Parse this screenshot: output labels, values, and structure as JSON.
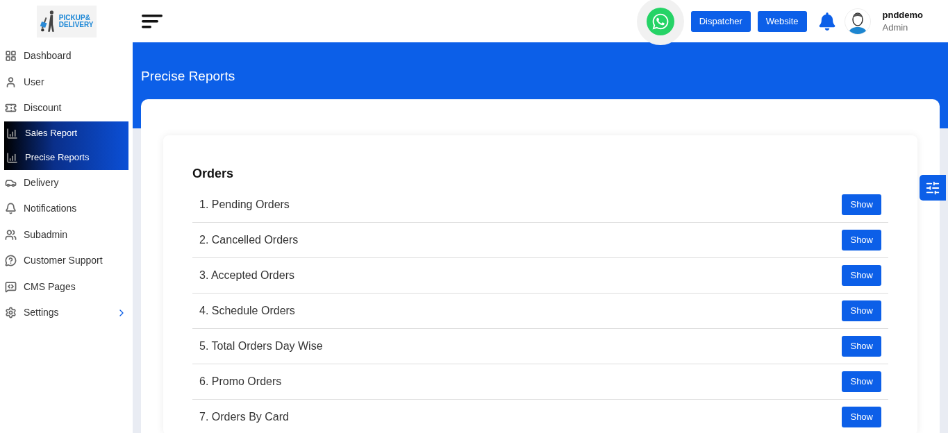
{
  "logo": {
    "line_1": "PICKUP&",
    "line_2": "DELIVERY"
  },
  "sidebar": {
    "items": [
      {
        "label": "Dashboard",
        "selected": false,
        "expandable": false
      },
      {
        "label": "User",
        "selected": false,
        "expandable": false
      },
      {
        "label": "Discount",
        "selected": false,
        "expandable": false
      },
      {
        "label": "Sales Report",
        "selected": true,
        "expandable": false
      },
      {
        "label": "Precise Reports",
        "selected": true,
        "expandable": false
      },
      {
        "label": "Delivery",
        "selected": false,
        "expandable": false
      },
      {
        "label": "Notifications",
        "selected": false,
        "expandable": false
      },
      {
        "label": "Subadmin",
        "selected": false,
        "expandable": false
      },
      {
        "label": "Customer Support",
        "selected": false,
        "expandable": false
      },
      {
        "label": "CMS Pages",
        "selected": false,
        "expandable": false
      },
      {
        "label": "Settings",
        "selected": false,
        "expandable": true
      }
    ]
  },
  "header": {
    "buttons": [
      "Dispatcher",
      "Website"
    ],
    "user": {
      "name": "pnddemo",
      "role": "Admin"
    }
  },
  "page_title": "Precise Reports",
  "section_title": "Orders",
  "reports": [
    {
      "label": "1. Pending Orders",
      "button": "Show"
    },
    {
      "label": "2. Cancelled Orders",
      "button": "Show"
    },
    {
      "label": "3. Accepted Orders",
      "button": "Show"
    },
    {
      "label": "4. Schedule Orders",
      "button": "Show"
    },
    {
      "label": "5. Total Orders Day Wise",
      "button": "Show"
    },
    {
      "label": "6. Promo Orders",
      "button": "Show"
    },
    {
      "label": "7. Orders By Card",
      "button": "Show"
    }
  ]
}
